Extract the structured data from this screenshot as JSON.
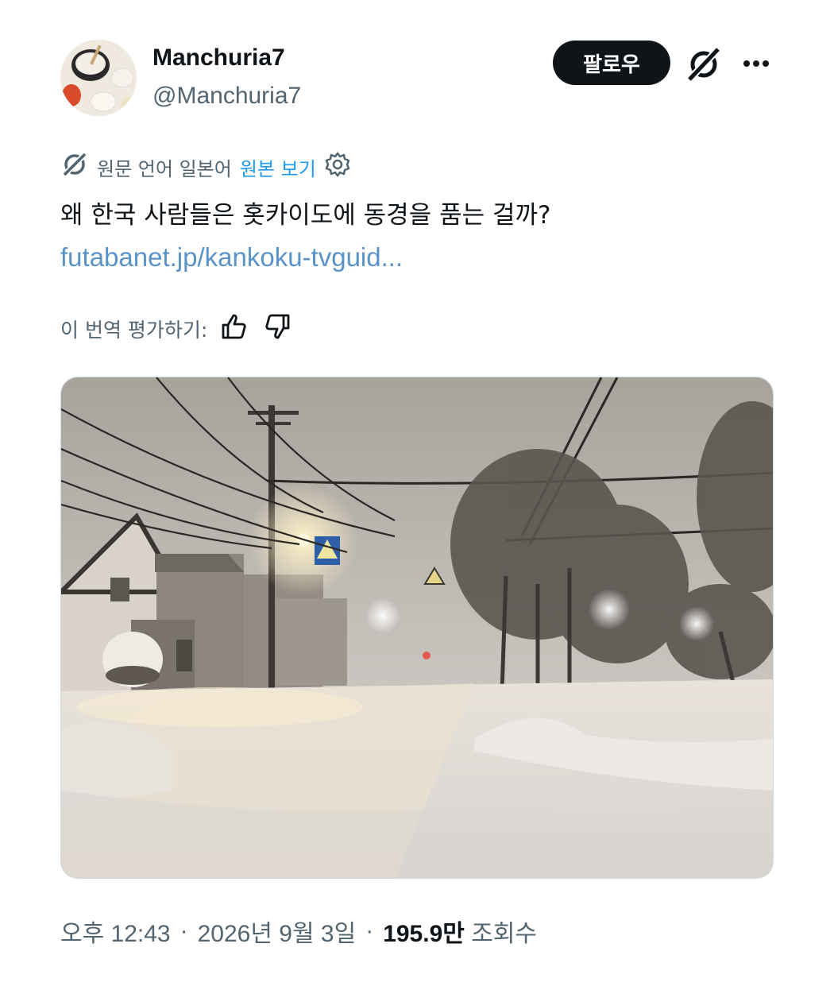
{
  "author": {
    "display_name": "Manchuria7",
    "handle": "@Manchuria7",
    "avatar_icon": "food-dishes-avatar"
  },
  "actions": {
    "follow_label": "팔로우",
    "grok_icon": "grok-icon",
    "more_icon": "more-dots-icon"
  },
  "translation": {
    "icon": "translate-icon",
    "source_label": "원문 언어 일본어",
    "view_original_label": "원본 보기",
    "settings_icon": "gear-icon"
  },
  "tweet": {
    "text": "왜 한국 사람들은 홋카이도에 동경을 품는 걸까?",
    "link": "futabanet.jp/kankoku-tvguid..."
  },
  "rating": {
    "label": "이 번역 평가하기:",
    "up_icon": "thumbs-up-icon",
    "down_icon": "thumbs-down-icon"
  },
  "media": {
    "description_icon": "snowy-street-photo"
  },
  "meta": {
    "time": "오후 12:43",
    "separator": "·",
    "date": "2026년 9월 3일",
    "views_count": "195.9만",
    "views_label": "조회수"
  },
  "colors": {
    "link": "#1d9bf0",
    "muted": "#536471",
    "text": "#0f1419"
  }
}
